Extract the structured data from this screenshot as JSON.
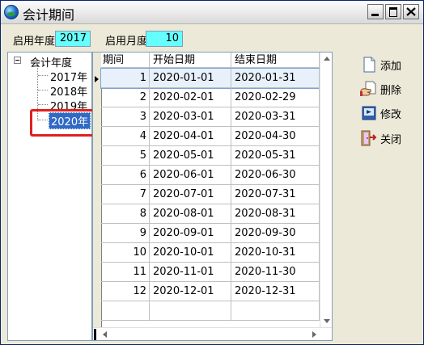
{
  "window": {
    "title": "会计期间"
  },
  "fields": {
    "year_label": "启用年度",
    "year_value": "2017",
    "month_label": "启用月度",
    "month_value": "10"
  },
  "tree": {
    "root": "会计年度",
    "items": [
      "2017年",
      "2018年",
      "2019年",
      "2020年"
    ],
    "selected": "2020年"
  },
  "grid": {
    "headers": [
      "期间",
      "开始日期",
      "结束日期"
    ],
    "rows": [
      [
        "1",
        "2020-01-01",
        "2020-01-31"
      ],
      [
        "2",
        "2020-02-01",
        "2020-02-29"
      ],
      [
        "3",
        "2020-03-01",
        "2020-03-31"
      ],
      [
        "4",
        "2020-04-01",
        "2020-04-30"
      ],
      [
        "5",
        "2020-05-01",
        "2020-05-31"
      ],
      [
        "6",
        "2020-06-01",
        "2020-06-30"
      ],
      [
        "7",
        "2020-07-01",
        "2020-07-31"
      ],
      [
        "8",
        "2020-08-01",
        "2020-08-31"
      ],
      [
        "9",
        "2020-09-01",
        "2020-09-30"
      ],
      [
        "10",
        "2020-10-01",
        "2020-10-31"
      ],
      [
        "11",
        "2020-11-01",
        "2020-11-30"
      ],
      [
        "12",
        "2020-12-01",
        "2020-12-31"
      ]
    ]
  },
  "buttons": {
    "add": "添加",
    "delete": "删除",
    "edit": "修改",
    "close": "关闭"
  },
  "icons": {
    "app": "globe-icon",
    "add": "new-document-icon",
    "delete": "delete-hand-icon",
    "edit": "edit-icon",
    "close": "exit-door-icon"
  },
  "colors": {
    "field_bg": "#66ffff",
    "selection": "#316ac5",
    "highlight_box": "#e02020"
  }
}
